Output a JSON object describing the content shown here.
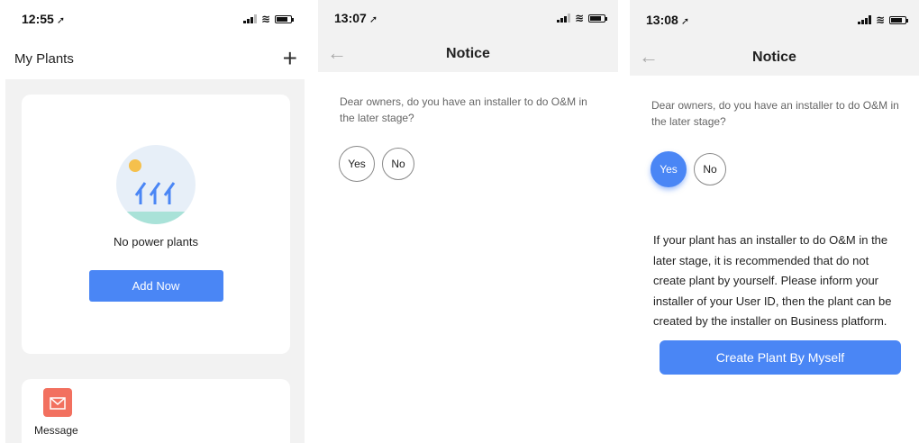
{
  "screen1": {
    "status": {
      "time": "12:55",
      "location_icon": "location-arrow-icon"
    },
    "header": {
      "title": "My Plants",
      "add_icon": "plus-icon"
    },
    "empty": {
      "text": "No power plants",
      "button": "Add Now",
      "illustration": "solar-panel-illustration"
    },
    "message": {
      "label": "Message",
      "icon": "mail-icon"
    }
  },
  "screen2": {
    "status": {
      "time": "13:07"
    },
    "nav": {
      "title": "Notice"
    },
    "question": "Dear owners, do you have an installer to do O&M in the later stage?",
    "options": {
      "yes": "Yes",
      "no": "No"
    }
  },
  "screen3": {
    "status": {
      "time": "13:08"
    },
    "nav": {
      "title": "Notice"
    },
    "question": "Dear owners, do you have an installer to do O&M in the later stage?",
    "options": {
      "yes": "Yes",
      "no": "No",
      "selected": "Yes"
    },
    "info": "If your plant has an installer to do O&M in the later stage, it is recommended that do not create plant by yourself. Please inform your installer of your User ID, then the plant can be created by the installer on Business platform.",
    "button": "Create Plant By Myself"
  },
  "colors": {
    "accent": "#4a86f5",
    "message_icon": "#f2705f",
    "background": "#f2f2f2"
  }
}
